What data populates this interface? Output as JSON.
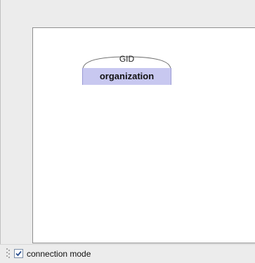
{
  "diagram": {
    "entity": {
      "attribute": "GID",
      "name": "organization",
      "fill_color": "#c8c8f0"
    }
  },
  "statusbar": {
    "connection_mode_label": "connection mode",
    "connection_mode_checked": true
  }
}
